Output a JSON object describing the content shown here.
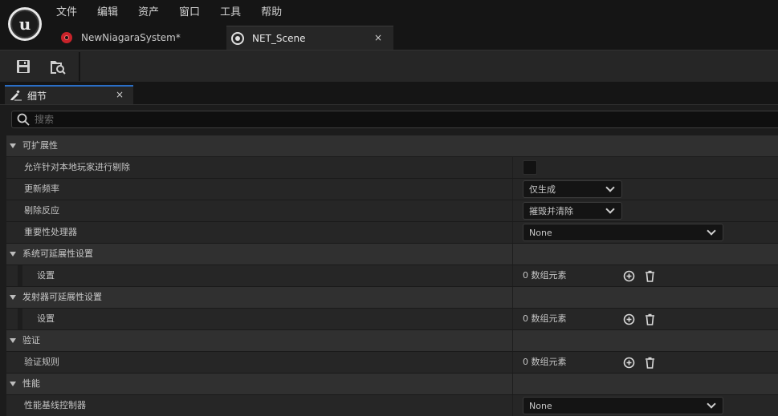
{
  "menu": [
    "文件",
    "编辑",
    "资产",
    "窗口",
    "工具",
    "帮助"
  ],
  "tabs": [
    {
      "label": "NewNiagaraSystem*",
      "icon": "niagara-system-icon"
    },
    {
      "label": "NET_Scene",
      "icon": "scene-icon",
      "close": "×"
    }
  ],
  "toolbar": {
    "save_icon": "save-icon",
    "browse_icon": "browse-asset-icon"
  },
  "panel": {
    "title": "细节",
    "close": "×"
  },
  "search": {
    "placeholder": "搜索"
  },
  "rows": [
    {
      "type": "category",
      "label": "可扩展性"
    },
    {
      "type": "prop",
      "label": "允许针对本地玩家进行剔除",
      "control": "checkbox",
      "checked": false
    },
    {
      "type": "prop",
      "label": "更新频率",
      "control": "combo",
      "value": "仅生成"
    },
    {
      "type": "prop",
      "label": "剔除反应",
      "control": "combo",
      "value": "摧毁并清除"
    },
    {
      "type": "prop",
      "label": "重要性处理器",
      "control": "combo-wide",
      "value": "None"
    },
    {
      "type": "category",
      "label": "系统可延展性设置"
    },
    {
      "type": "prop-indent",
      "label": "设置",
      "control": "array",
      "value": "0 数组元素"
    },
    {
      "type": "category",
      "label": "发射器可延展性设置"
    },
    {
      "type": "prop-indent",
      "label": "设置",
      "control": "array",
      "value": "0 数组元素"
    },
    {
      "type": "category",
      "label": "验证"
    },
    {
      "type": "prop",
      "label": "验证规则",
      "control": "array",
      "value": "0 数组元素"
    },
    {
      "type": "category",
      "label": "性能"
    },
    {
      "type": "prop",
      "label": "性能基线控制器",
      "control": "combo-wide",
      "value": "None"
    }
  ]
}
